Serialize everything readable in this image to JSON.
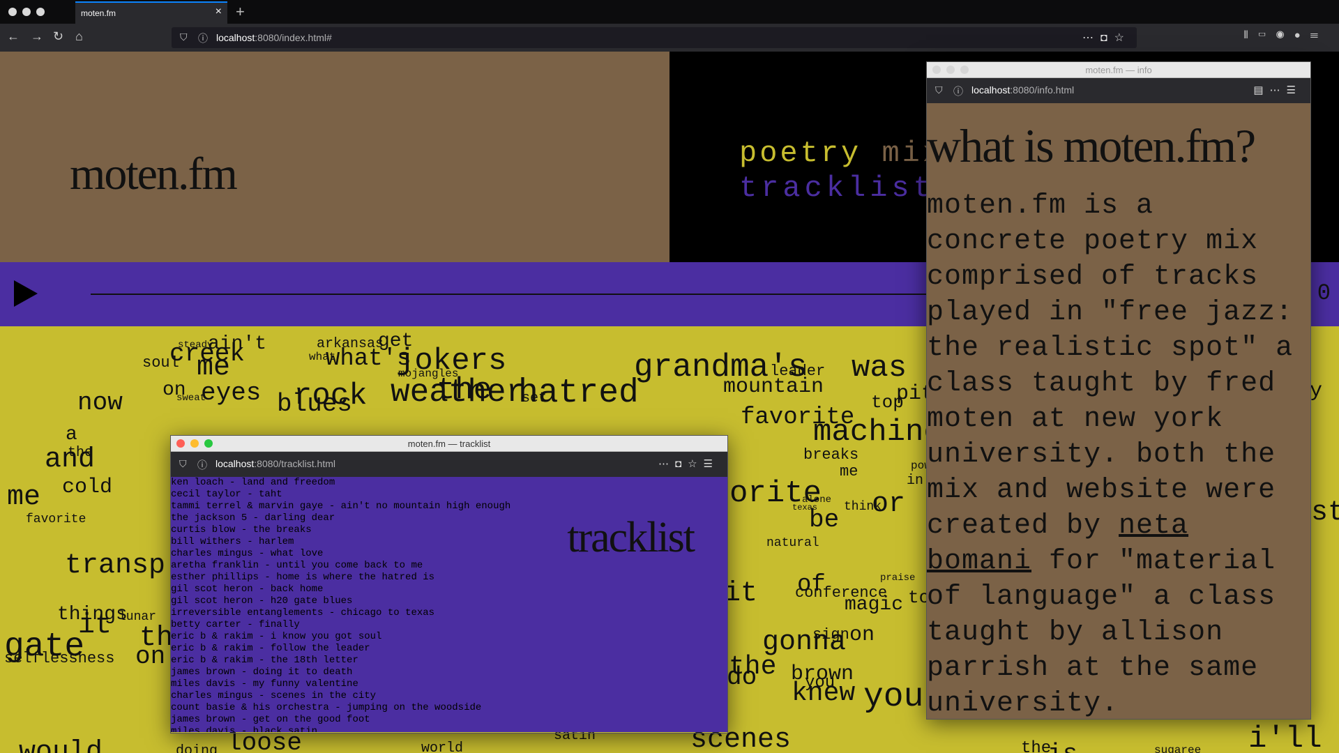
{
  "browser": {
    "tab_title": "moten.fm",
    "tab_close": "×",
    "new_tab": "+",
    "url_host": "localhost",
    "url_path": ":8080/index.html#",
    "icons": [
      "back-arrow-icon",
      "forward-arrow-icon",
      "reload-icon",
      "home-icon",
      "shield-icon",
      "info-icon",
      "more-icon",
      "pocket-icon",
      "star-icon",
      "library-icon",
      "sidebar-icon",
      "account-icon",
      "menu-icon"
    ]
  },
  "hero": {
    "logo": "moten.fm",
    "mix_word1": "poetry",
    "mix_word2": "mix",
    "tracklist_link": "tracklist"
  },
  "player": {
    "time": "0",
    "progress": 0
  },
  "word_cloud": [
    {
      "t": "ain't",
      "s": 28
    },
    {
      "t": "steady",
      "s": 14
    },
    {
      "t": "arkansas",
      "s": 20
    },
    {
      "t": "get",
      "s": 28
    },
    {
      "t": "creek",
      "s": 36
    },
    {
      "t": "soul",
      "s": 22
    },
    {
      "t": "me",
      "s": 40
    },
    {
      "t": "what",
      "s": 16
    },
    {
      "t": "what's",
      "s": 34
    },
    {
      "t": "jokers",
      "s": 44
    },
    {
      "t": "grandma's",
      "s": 46
    },
    {
      "t": "was",
      "s": 44
    },
    {
      "t": "leader",
      "s": 22
    },
    {
      "t": "mojangles",
      "s": 16
    },
    {
      "t": "the",
      "s": 44
    },
    {
      "t": "hatred",
      "s": 48
    },
    {
      "t": "weather",
      "s": 46
    },
    {
      "t": "on",
      "s": 28
    },
    {
      "t": "eyes",
      "s": 36
    },
    {
      "t": "sweat",
      "s": 14
    },
    {
      "t": "rock",
      "s": 44
    },
    {
      "t": "blues",
      "s": 36
    },
    {
      "t": "mountain",
      "s": 30
    },
    {
      "t": "top",
      "s": 26
    },
    {
      "t": "pit",
      "s": 30
    },
    {
      "t": "now",
      "s": 36
    },
    {
      "t": "set",
      "s": 20
    },
    {
      "t": "favorite",
      "s": 34
    },
    {
      "t": "machine",
      "s": 44
    },
    {
      "t": "a",
      "s": 28
    },
    {
      "t": "and",
      "s": 40
    },
    {
      "t": "the",
      "s": 20
    },
    {
      "t": "breaks",
      "s": 22
    },
    {
      "t": "me",
      "s": 22
    },
    {
      "t": "cold",
      "s": 30
    },
    {
      "t": "me",
      "s": 40
    },
    {
      "t": "favorite",
      "s": 18
    },
    {
      "t": "orite",
      "s": 44
    },
    {
      "t": "alone",
      "s": 14
    },
    {
      "t": "texas",
      "s": 12
    },
    {
      "t": "think",
      "s": 18
    },
    {
      "t": "be",
      "s": 36
    },
    {
      "t": "or",
      "s": 40
    },
    {
      "t": "power",
      "s": 16
    },
    {
      "t": "in",
      "s": 20
    },
    {
      "t": "natural",
      "s": 18
    },
    {
      "t": "transp",
      "s": 40
    },
    {
      "t": "it",
      "s": 40
    },
    {
      "t": "of",
      "s": 34
    },
    {
      "t": "praise",
      "s": 14
    },
    {
      "t": "conference",
      "s": 22
    },
    {
      "t": "magic",
      "s": 28
    },
    {
      "t": "to",
      "s": 26
    },
    {
      "t": "things",
      "s": 28
    },
    {
      "t": "lunar",
      "s": 18
    },
    {
      "t": "it",
      "s": 40
    },
    {
      "t": "gate",
      "s": 48
    },
    {
      "t": "the",
      "s": 40
    },
    {
      "t": "gonna",
      "s": 40
    },
    {
      "t": "sign",
      "s": 22
    },
    {
      "t": "on",
      "s": 30
    },
    {
      "t": "selflessness",
      "s": 22
    },
    {
      "t": "on",
      "s": 36
    },
    {
      "t": "the",
      "s": 38
    },
    {
      "t": "do",
      "s": 36
    },
    {
      "t": "brown",
      "s": 30
    },
    {
      "t": "you",
      "s": 24
    },
    {
      "t": "knew",
      "s": 38
    },
    {
      "t": "you",
      "s": 48
    },
    {
      "t": "scenes",
      "s": 40
    },
    {
      "t": "satin",
      "s": 20
    },
    {
      "t": "world",
      "s": 20
    },
    {
      "t": "loose",
      "s": 36
    },
    {
      "t": "would",
      "s": 40
    },
    {
      "t": "doing",
      "s": 20
    },
    {
      "t": "the",
      "s": 24
    },
    {
      "t": "is",
      "s": 36
    },
    {
      "t": "sugaree",
      "s": 16
    },
    {
      "t": "i'll",
      "s": 44
    },
    {
      "t": "st",
      "s": 40
    },
    {
      "t": "y",
      "s": 30
    }
  ],
  "tracklist_window": {
    "title": "moten.fm — tracklist",
    "url_host": "localhost",
    "url_path": ":8080/tracklist.html",
    "heading": "tracklist",
    "tracks": [
      "ken loach - land and freedom",
      "cecil taylor - taht",
      "tammi terrel & marvin gaye - ain't no mountain high enough",
      "the jackson 5 - darling dear",
      "curtis blow - the breaks",
      "bill withers - harlem",
      "charles mingus - what love",
      "aretha franklin - until you come back to me",
      "esther phillips - home is where the hatred is",
      "gil scot heron - back home",
      "gil scot heron - h20 gate blues",
      "irreversible entanglements - chicago to texas",
      "betty carter - finally",
      "eric b & rakim - i know you got soul",
      "eric b & rakim - follow the leader",
      "eric b & rakim - the 18th letter",
      "james brown - doing it to death",
      "miles davis - my funny valentine",
      "charles mingus - scenes in the city",
      "count basie & his orchestra - jumping on the woodside",
      "james brown - get on the good foot",
      "miles davis - black satin"
    ]
  },
  "info_window": {
    "title": "moten.fm — info",
    "url_host": "localhost",
    "url_path": ":8080/info.html",
    "heading": "what is moten.fm?",
    "body_before": "moten.fm is a concrete poetry mix comprised of tracks played in \"free jazz: the realistic spot\" a class taught by fred moten at new york university. both the mix and website were created by ",
    "author_link": "neta bomani",
    "body_after": " for \"material of language\" a class taught by allison parrish at the same university."
  },
  "colors": {
    "brown": "#7b6247",
    "purple": "#4b2ea1",
    "yellow": "#c7bd2f",
    "black": "#000000"
  }
}
